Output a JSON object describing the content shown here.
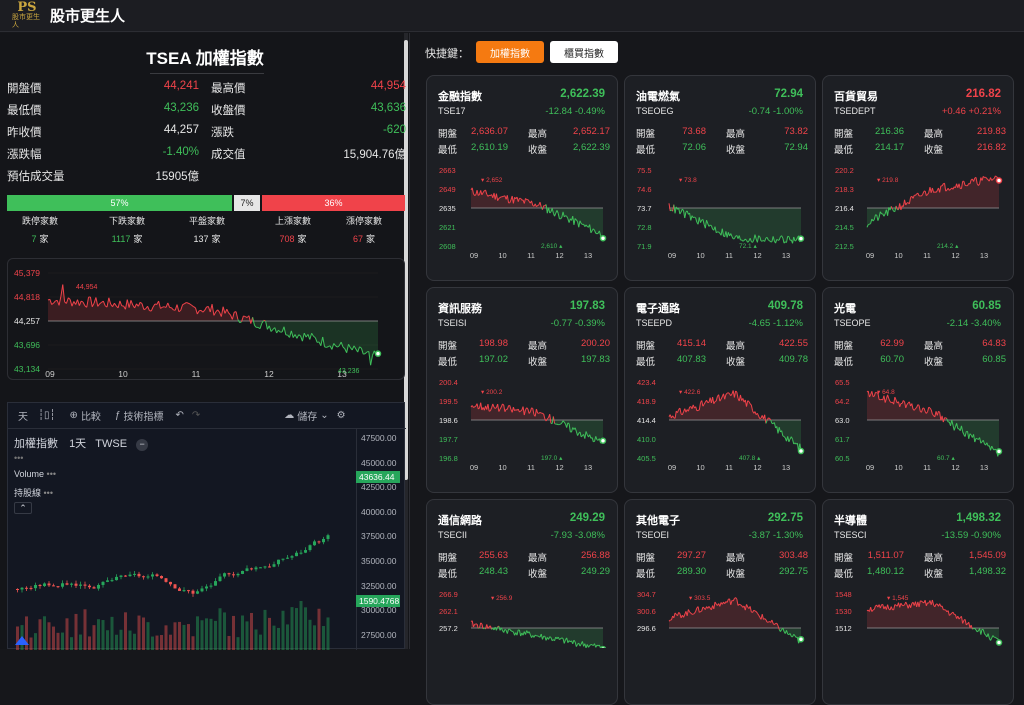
{
  "app": {
    "logo_text": "PS",
    "logo_sub": "股市更生人",
    "title": "股市更生人"
  },
  "index": {
    "title": "TSEA 加權指數",
    "rows": [
      {
        "l1": "開盤價",
        "v1": "44,241",
        "c1": "red",
        "l2": "最高價",
        "v2": "44,954",
        "c2": "red"
      },
      {
        "l1": "最低價",
        "v1": "43,236",
        "c1": "green",
        "l2": "收盤價",
        "v2": "43,636",
        "c2": "green"
      },
      {
        "l1": "昨收價",
        "v1": "44,257",
        "c1": "white",
        "l2": "漲跌",
        "v2": "-620",
        "c2": "green"
      },
      {
        "l1": "漲跌幅",
        "v1": "-1.40%",
        "c1": "green",
        "l2": "成交值",
        "v2": "15,904.76億",
        "c2": "white"
      },
      {
        "l1": "預估成交量",
        "v1": "15905億",
        "c1": "white",
        "l2": "",
        "v2": "",
        "c2": "white"
      }
    ],
    "breadth": {
      "down_pct": 57,
      "down_label": "57%",
      "flat_pct": 7,
      "flat_label": "7%",
      "up_pct": 36,
      "up_label": "36%"
    },
    "counts": [
      {
        "label": "跌停家數",
        "value": "7",
        "unit": "家",
        "color": "green"
      },
      {
        "label": "下跌家數",
        "value": "1117",
        "unit": "家",
        "color": "green"
      },
      {
        "label": "平盤家數",
        "value": "137",
        "unit": "家",
        "color": "white"
      },
      {
        "label": "上漲家數",
        "value": "708",
        "unit": "家",
        "color": "red"
      },
      {
        "label": "漲停家數",
        "value": "67",
        "unit": "家",
        "color": "red"
      }
    ]
  },
  "main_chart": {
    "y_labels": [
      "45,379",
      "44,818",
      "44,257",
      "43,696",
      "43,134"
    ],
    "x_labels": [
      "09",
      "10",
      "11",
      "12",
      "13"
    ],
    "high_label": "44,954",
    "low_label": "43,236",
    "ref": 44257,
    "ymin": 43134,
    "ymax": 45379
  },
  "tv": {
    "tools": {
      "interval": "天",
      "compare": "比較",
      "indicators": "技術指標",
      "save": "儲存"
    },
    "symbol": "加權指數",
    "period": "1天",
    "exchange": "TWSE",
    "volume_label": "Volume",
    "holding_label": "持股線",
    "price_axis": [
      "47500.00",
      "45000.00",
      "42500.00",
      "40000.00",
      "37500.00",
      "35000.00",
      "32500.00",
      "30000.00",
      "27500.00"
    ],
    "last_price": "43636.44",
    "volume_tag": "1590.4768"
  },
  "shortcuts": {
    "label": "快捷鍵：",
    "active": "加權指數",
    "normal": "櫃買指數"
  },
  "common": {
    "open": "開盤",
    "high": "最高",
    "low": "最低",
    "close": "收盤"
  },
  "sectors": [
    {
      "name": "金融指數",
      "code": "TSE17",
      "price": "2,622.39",
      "change": "-12.84  -0.49%",
      "dir": "down",
      "open": "2,636.07",
      "open_c": "red",
      "high": "2,652.17",
      "high_c": "red",
      "low": "2,610.19",
      "low_c": "green",
      "close": "2,622.39",
      "close_c": "green",
      "y_labels": [
        "2663",
        "2649",
        "2635",
        "2621",
        "2608"
      ],
      "ref_label": "2635",
      "hi_mark": "2,652",
      "lo_mark": "2,610",
      "x_labels": [
        "09",
        "10",
        "11",
        "12",
        "13"
      ],
      "shape": [
        0.72,
        0.55,
        0.15
      ]
    },
    {
      "name": "油電燃氣",
      "code": "TSEOEG",
      "price": "72.94",
      "change": "-0.74  -1.00%",
      "dir": "down",
      "open": "73.68",
      "open_c": "red",
      "high": "73.82",
      "high_c": "red",
      "low": "72.06",
      "low_c": "green",
      "close": "72.94",
      "close_c": "green",
      "y_labels": [
        "75.5",
        "74.6",
        "73.7",
        "72.8",
        "71.9"
      ],
      "ref_label": "73.7",
      "hi_mark": "73.8",
      "lo_mark": "72.1",
      "x_labels": [
        "09",
        "10",
        "11",
        "12",
        "13"
      ],
      "shape": [
        0.52,
        0.1,
        0.08
      ]
    },
    {
      "name": "百貨貿易",
      "code": "TSEDEPT",
      "price": "216.82",
      "change": "+0.46  +0.21%",
      "dir": "up",
      "open": "216.36",
      "open_c": "green",
      "high": "219.83",
      "high_c": "red",
      "low": "214.17",
      "low_c": "green",
      "close": "216.82",
      "close_c": "red",
      "y_labels": [
        "220.2",
        "218.3",
        "216.4",
        "214.5",
        "212.5"
      ],
      "ref_label": "216.4",
      "hi_mark": "219.8",
      "lo_mark": "214.2",
      "x_labels": [
        "09",
        "10",
        "11",
        "12",
        "13"
      ],
      "shape": [
        0.3,
        0.75,
        0.9
      ]
    },
    {
      "name": "資訊服務",
      "code": "TSEISI",
      "price": "197.83",
      "change": "-0.77  -0.39%",
      "dir": "down",
      "open": "198.98",
      "open_c": "red",
      "high": "200.20",
      "high_c": "red",
      "low": "197.02",
      "low_c": "green",
      "close": "197.83",
      "close_c": "green",
      "y_labels": [
        "200.4",
        "199.5",
        "198.6",
        "197.7",
        "196.8"
      ],
      "ref_label": "198.6",
      "hi_mark": "200.2",
      "lo_mark": "197.0",
      "x_labels": [
        "09",
        "10",
        "11",
        "12",
        "13"
      ],
      "shape": [
        0.7,
        0.6,
        0.2
      ]
    },
    {
      "name": "電子通路",
      "code": "TSEEPD",
      "price": "409.78",
      "change": "-4.65  -1.12%",
      "dir": "down",
      "open": "415.14",
      "open_c": "red",
      "high": "422.55",
      "high_c": "red",
      "low": "407.83",
      "low_c": "green",
      "close": "409.78",
      "close_c": "green",
      "y_labels": [
        "423.4",
        "418.9",
        "414.4",
        "410.0",
        "405.5"
      ],
      "ref_label": "414.4",
      "hi_mark": "422.6",
      "lo_mark": "407.8",
      "x_labels": [
        "09",
        "10",
        "11",
        "12",
        "13"
      ],
      "shape": [
        0.55,
        0.85,
        0.12
      ]
    },
    {
      "name": "光電",
      "code": "TSEOPE",
      "price": "60.85",
      "change": "-2.14  -3.40%",
      "dir": "down",
      "open": "62.99",
      "open_c": "red",
      "high": "64.83",
      "high_c": "red",
      "low": "60.70",
      "low_c": "green",
      "close": "60.85",
      "close_c": "green",
      "y_labels": [
        "65.5",
        "64.2",
        "63.0",
        "61.7",
        "60.5"
      ],
      "ref_label": "63.0",
      "hi_mark": "64.8",
      "lo_mark": "60.7",
      "x_labels": [
        "09",
        "10",
        "11",
        "12",
        "13"
      ],
      "shape": [
        0.85,
        0.6,
        0.05
      ]
    },
    {
      "name": "通信網路",
      "code": "TSECII",
      "price": "249.29",
      "change": "-7.93  -3.08%",
      "dir": "down",
      "open": "255.63",
      "open_c": "red",
      "high": "256.88",
      "high_c": "red",
      "low": "248.43",
      "low_c": "green",
      "close": "249.29",
      "close_c": "green",
      "y_labels": [
        "266.9",
        "262.1",
        "257.2"
      ],
      "ref_label": "257.2",
      "hi_mark": "256.9",
      "lo_mark": "",
      "x_labels": [],
      "shape": [
        0.5,
        0.3,
        0.1
      ]
    },
    {
      "name": "其他電子",
      "code": "TSEOEI",
      "price": "292.75",
      "change": "-3.87  -1.30%",
      "dir": "down",
      "open": "297.27",
      "open_c": "red",
      "high": "303.48",
      "high_c": "red",
      "low": "289.30",
      "low_c": "green",
      "close": "292.75",
      "close_c": "green",
      "y_labels": [
        "304.7",
        "300.6",
        "296.6"
      ],
      "ref_label": "296.6",
      "hi_mark": "303.5",
      "lo_mark": "",
      "x_labels": [],
      "shape": [
        0.6,
        0.9,
        0.2
      ]
    },
    {
      "name": "半導體",
      "code": "TSESCI",
      "price": "1,498.32",
      "change": "-13.59  -0.90%",
      "dir": "down",
      "open": "1,511.07",
      "open_c": "red",
      "high": "1,545.09",
      "high_c": "red",
      "low": "1,480.12",
      "low_c": "green",
      "close": "1,498.32",
      "close_c": "green",
      "y_labels": [
        "1548",
        "1530",
        "1512"
      ],
      "ref_label": "1512",
      "hi_mark": "1,545",
      "lo_mark": "",
      "x_labels": [],
      "shape": [
        0.75,
        0.85,
        0.2
      ]
    }
  ],
  "colors": {
    "up": "#f0434a",
    "down": "#3fbf5a",
    "flat": "#e6e6e6",
    "accent": "#f57a11"
  }
}
